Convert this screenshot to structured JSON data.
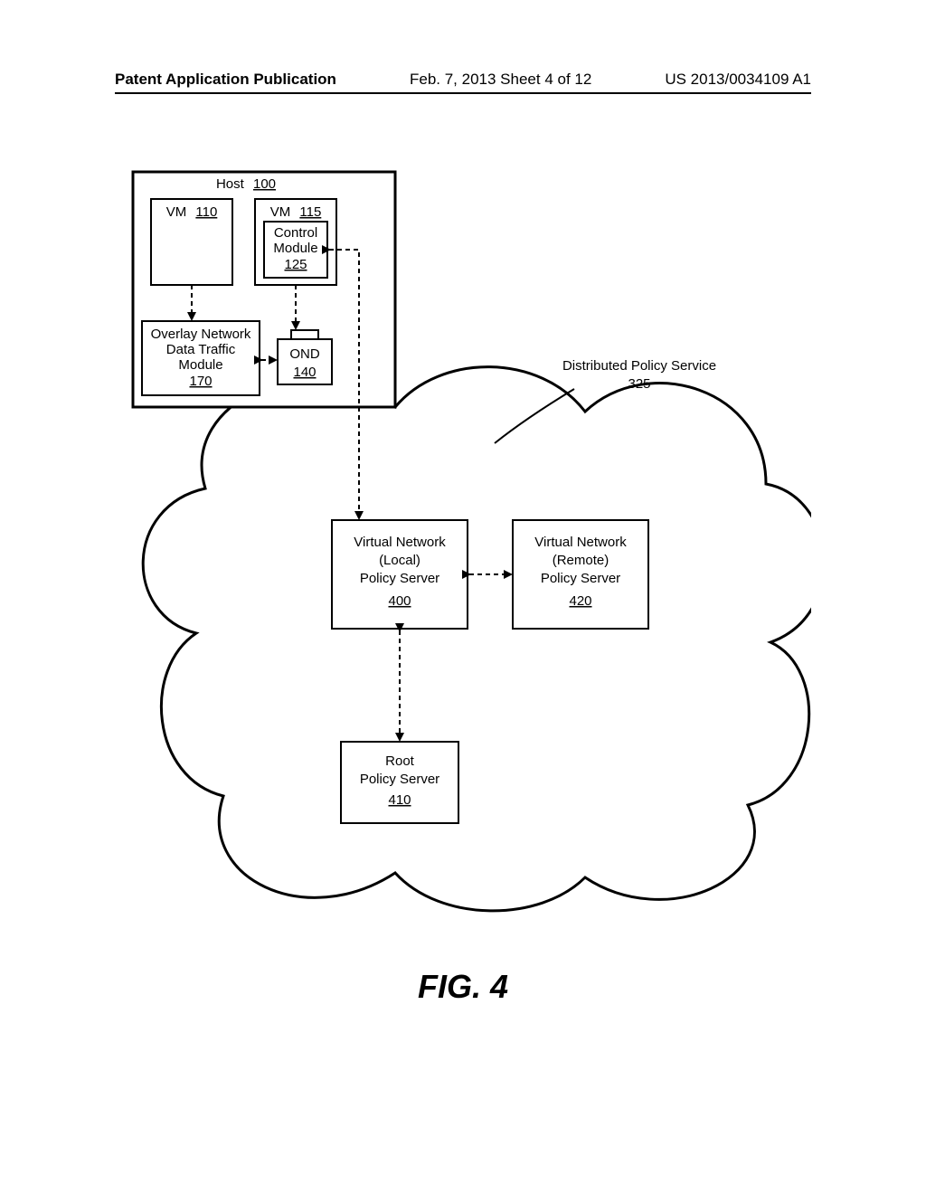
{
  "header": {
    "left": "Patent Application Publication",
    "mid": "Feb. 7, 2013   Sheet 4 of 12",
    "right": "US 2013/0034109 A1"
  },
  "figure_caption": "FIG. 4",
  "host": {
    "title_prefix": "Host",
    "title_ref": "100"
  },
  "vm110": {
    "title_prefix": "VM",
    "title_ref": "110"
  },
  "vm115": {
    "title_prefix": "VM",
    "title_ref": "115"
  },
  "control_module": {
    "line1": "Control",
    "line2": "Module",
    "ref": "125"
  },
  "overlay": {
    "line1": "Overlay Network",
    "line2": "Data Traffic",
    "line3": "Module",
    "ref": "170"
  },
  "ond": {
    "title": "OND",
    "ref": "140"
  },
  "dps_label": {
    "line1": "Distributed Policy Service",
    "line2": "325"
  },
  "vn_local": {
    "line1": "Virtual Network",
    "line2": "(Local)",
    "line3": "Policy Server",
    "ref": "400"
  },
  "vn_remote": {
    "line1": "Virtual Network",
    "line2": "(Remote)",
    "line3": "Policy Server",
    "ref": "420"
  },
  "root": {
    "line1": "Root",
    "line2": "Policy Server",
    "ref": "410"
  }
}
